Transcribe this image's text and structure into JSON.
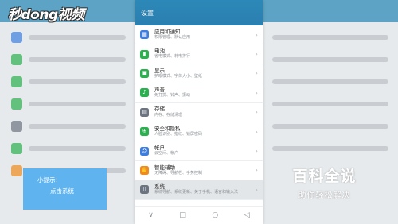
{
  "watermark": {
    "logo_text": "秒dong视频"
  },
  "screen": {
    "title": "设置",
    "items": [
      {
        "title": "应用和通知",
        "subtitle": "权限管理、默认应用",
        "icon": "apps-icon",
        "color": "#3d7de0",
        "glyph": "▦"
      },
      {
        "title": "电池",
        "subtitle": "省电模式、耗电排行",
        "icon": "battery-icon",
        "color": "#2ab04e",
        "glyph": "▮"
      },
      {
        "title": "显示",
        "subtitle": "护眼模式、字体大小、壁纸",
        "icon": "display-icon",
        "color": "#2ab04e",
        "glyph": "▣"
      },
      {
        "title": "声音",
        "subtitle": "免打扰、铃声、振动",
        "icon": "sound-icon",
        "color": "#2ab04e",
        "glyph": "♪"
      },
      {
        "title": "存储",
        "subtitle": "内存、存储清理",
        "icon": "storage-icon",
        "color": "#6b7480",
        "glyph": "▤"
      },
      {
        "title": "安全和隐私",
        "subtitle": "人脸识别、指纹、锁屏密码",
        "icon": "security-icon",
        "color": "#2ab04e",
        "glyph": "⛨"
      },
      {
        "title": "帐户",
        "subtitle": "云空间、帐户",
        "icon": "account-icon",
        "color": "#3d7de0",
        "glyph": "☺"
      },
      {
        "title": "智能辅助",
        "subtitle": "无障碍、导航栏、手势控制",
        "icon": "assist-icon",
        "color": "#f08a1c",
        "glyph": "✋"
      },
      {
        "title": "系统",
        "subtitle": "系统导航、系统更新、关于手机、语言和输入法",
        "icon": "system-icon",
        "color": "#6b7480",
        "glyph": "▯"
      }
    ],
    "nav": {
      "back": "∨",
      "home": "□",
      "recent": "○",
      "menu": "◁"
    }
  },
  "tip": {
    "line1": "小提示：",
    "line2": "点击系统"
  },
  "baike": {
    "title": "百科全说",
    "subtitle": "助你轻松解决"
  }
}
